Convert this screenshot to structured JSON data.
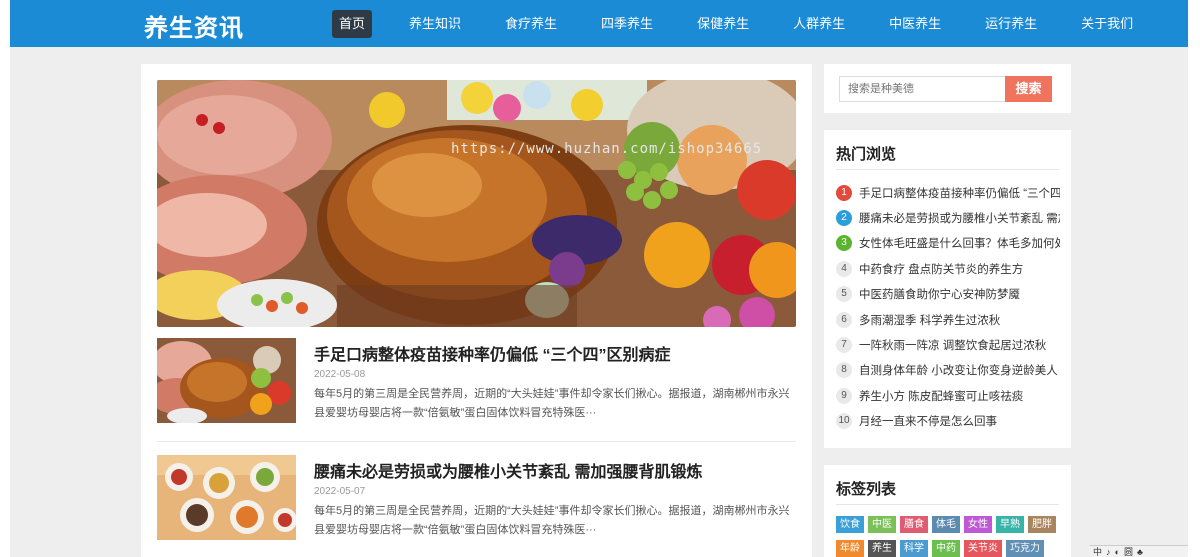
{
  "header": {
    "logo": "养生资讯",
    "nav": [
      "首页",
      "养生知识",
      "食疗养生",
      "四季养生",
      "保健养生",
      "人群养生",
      "中医养生",
      "运行养生",
      "关于我们"
    ]
  },
  "banner": {
    "watermark": "https://www.huzhan.com/ishop34665"
  },
  "articles": [
    {
      "title": "手足口病整体疫苗接种率仍偏低 “三个四”区别病症",
      "date": "2022-05-08",
      "desc": "每年5月的第三周是全民营养周，近期的“大头娃娃”事件却令家长们揪心。据报道，湖南郴州市永兴县爱婴坊母婴店将一款“倍氨敏”蛋白固体饮料冒充特殊医···"
    },
    {
      "title": "腰痛未必是劳损或为腰椎小关节紊乱 需加强腰背肌锻炼",
      "date": "2022-05-07",
      "desc": "每年5月的第三周是全民营养周，近期的“大头娃娃”事件却令家长们揪心。据报道，湖南郴州市永兴县爱婴坊母婴店将一款“倍氨敏”蛋白固体饮料冒充特殊医···"
    }
  ],
  "search": {
    "placeholder": "搜索是种美德",
    "button": "搜索"
  },
  "hot": {
    "title": "热门浏览",
    "items": [
      {
        "rank": "1",
        "text": "手足口病整体疫苗接种率仍偏低 “三个四”"
      },
      {
        "rank": "2",
        "text": "腰痛未必是劳损或为腰椎小关节紊乱 需加"
      },
      {
        "rank": "3",
        "text": "女性体毛旺盛是什么回事？体毛多加何处"
      },
      {
        "rank": "4",
        "text": "中药食疗 盘点防关节炎的养生方"
      },
      {
        "rank": "5",
        "text": "中医药膳食助你宁心安神防梦魇"
      },
      {
        "rank": "6",
        "text": "多雨潮湿季 科学养生过浓秋"
      },
      {
        "rank": "7",
        "text": "一阵秋雨一阵凉 调整饮食起居过浓秋"
      },
      {
        "rank": "8",
        "text": "自测身体年龄 小改变让你变身逆龄美人"
      },
      {
        "rank": "9",
        "text": "养生小方 陈皮配蜂蜜可止咳祛痰"
      },
      {
        "rank": "10",
        "text": "月经一直来不停是怎么回事"
      }
    ]
  },
  "tags": {
    "title": "标签列表",
    "items": [
      {
        "label": "饮食",
        "color": "#3b9fd8"
      },
      {
        "label": "中医",
        "color": "#7cc05a"
      },
      {
        "label": "膳食",
        "color": "#e05c73"
      },
      {
        "label": "体毛",
        "color": "#5c8bb0"
      },
      {
        "label": "女性",
        "color": "#bf58d6"
      },
      {
        "label": "早熟",
        "color": "#38b3a8"
      },
      {
        "label": "肥胖",
        "color": "#a8855f"
      },
      {
        "label": "年龄",
        "color": "#f08a2c"
      },
      {
        "label": "养生",
        "color": "#555555"
      },
      {
        "label": "科学",
        "color": "#4a9bd1"
      },
      {
        "label": "中药",
        "color": "#6cbf4e"
      },
      {
        "label": "关节炎",
        "color": "#e6575d"
      },
      {
        "label": "巧克力",
        "color": "#5f8fb4"
      }
    ]
  },
  "tray": [
    "中",
    "♪",
    "◐",
    "圆",
    "♣"
  ]
}
